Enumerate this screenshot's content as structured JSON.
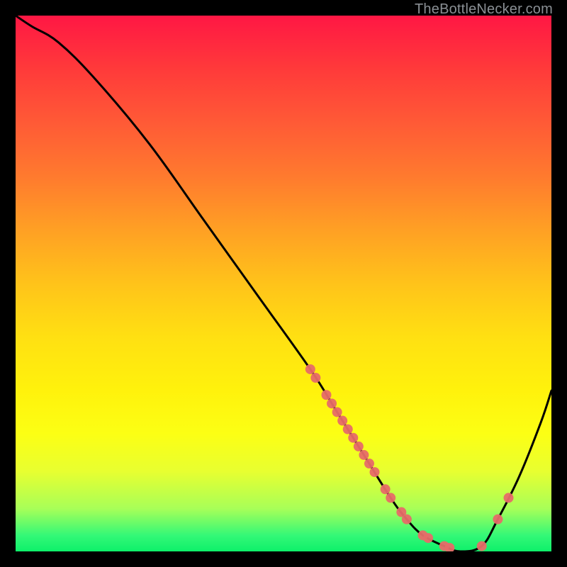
{
  "watermark": "TheBottleNecker.com",
  "chart_data": {
    "type": "line",
    "title": "",
    "xlabel": "",
    "ylabel": "",
    "xlim": [
      0,
      100
    ],
    "ylim": [
      0,
      100
    ],
    "x": [
      0,
      3,
      8,
      15,
      25,
      35,
      45,
      55,
      60,
      65,
      70,
      73,
      76,
      80,
      83,
      87,
      90,
      94,
      98,
      100
    ],
    "values": [
      100,
      98,
      95,
      88,
      76,
      62,
      48,
      34,
      26,
      18,
      10,
      6,
      3,
      1,
      0,
      1,
      6,
      14,
      24,
      30
    ],
    "highlighted_x": [
      55,
      56,
      58,
      59,
      60,
      61,
      62,
      63,
      64,
      65,
      66,
      67,
      69,
      70,
      72,
      73,
      76,
      77,
      80,
      81,
      87,
      90,
      92
    ],
    "gradient": {
      "top": "#ff1744",
      "mid": "#ffe012",
      "bottom": "#0ef06a"
    },
    "marker_color": "#e76b68",
    "line_color": "#000000"
  }
}
